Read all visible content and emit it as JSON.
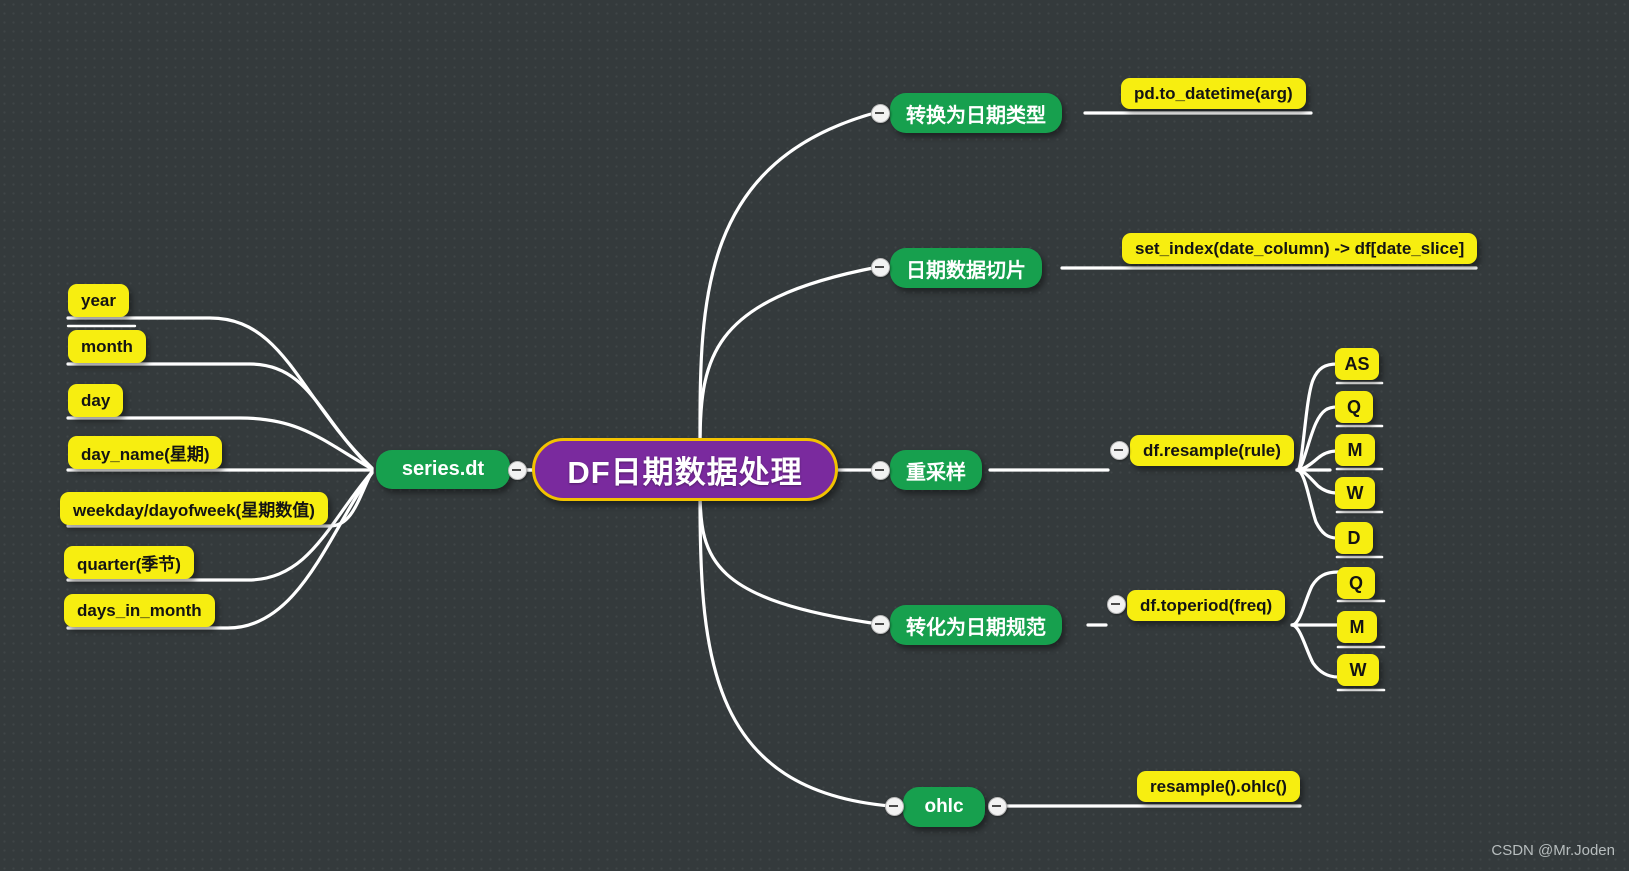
{
  "diagram": {
    "title": "DF日期数据处理",
    "watermark": "CSDN @Mr.Joden",
    "colors": {
      "background": "#343a3c",
      "central_fill": "#7a2a9e",
      "central_border": "#f2c200",
      "branch_fill": "#17a04e",
      "leaf_fill": "#f7ee10",
      "edge": "#ffffff"
    }
  },
  "central": {
    "label": "DF日期数据处理"
  },
  "left_branch": {
    "label": "series.dt",
    "leaves": [
      {
        "label": "year"
      },
      {
        "label": "month"
      },
      {
        "label": "day"
      },
      {
        "label": "day_name(星期)"
      },
      {
        "label": "weekday/dayofweek(星期数值)"
      },
      {
        "label": "quarter(季节)"
      },
      {
        "label": "days_in_month"
      }
    ]
  },
  "right_branches": [
    {
      "label": "转换为日期类型",
      "leaves": [
        {
          "label": "pd.to_datetime(arg)",
          "children": []
        }
      ]
    },
    {
      "label": "日期数据切片",
      "leaves": [
        {
          "label": "set_index(date_column) -> df[date_slice]",
          "children": []
        }
      ]
    },
    {
      "label": "重采样",
      "leaves": [
        {
          "label": "df.resample(rule)",
          "children": [
            {
              "label": "AS"
            },
            {
              "label": "Q"
            },
            {
              "label": "M"
            },
            {
              "label": "W"
            },
            {
              "label": "D"
            }
          ]
        }
      ]
    },
    {
      "label": "转化为日期规范",
      "leaves": [
        {
          "label": "df.toperiod(freq)",
          "children": [
            {
              "label": "Q"
            },
            {
              "label": "M"
            },
            {
              "label": "W"
            }
          ]
        }
      ]
    },
    {
      "label": "ohlc",
      "leaves": [
        {
          "label": "resample().ohlc()",
          "children": []
        }
      ]
    }
  ]
}
